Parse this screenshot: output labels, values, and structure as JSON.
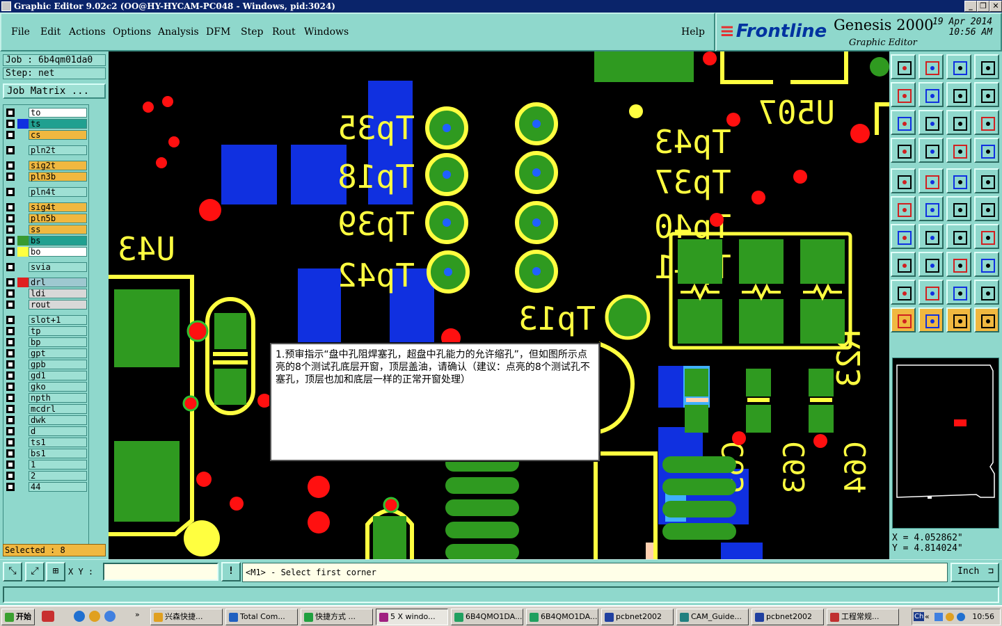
{
  "window": {
    "title": "Graphic Editor 9.02c2  (OO@HY-HYCAM-PC048 - Windows, pid:3024)",
    "minimize": "_",
    "restore": "❐",
    "close": "✕"
  },
  "menu": {
    "items": [
      "File",
      "Edit",
      "Actions",
      "Options",
      "Analysis",
      "DFM",
      "Step",
      "Rout",
      "Windows"
    ],
    "help": "Help"
  },
  "logo": {
    "brand": "Frontline",
    "product": "Genesis 2000",
    "subtitle": "Graphic Editor",
    "date": "19 Apr 2014",
    "time": "10:56 AM"
  },
  "left": {
    "job": "Job : 6b4qm01da0",
    "step": "Step: net",
    "job_matrix": "Job Matrix ...",
    "selected": "Selected : 8",
    "layers": [
      {
        "name": "to",
        "color": "#ffffff",
        "swatch": "#8fd8cc",
        "mark": "⬋"
      },
      {
        "name": "ts",
        "color": "#20a090",
        "swatch": "#1030e0",
        "mark": "⬋"
      },
      {
        "name": "cs",
        "color": "#f0b840",
        "swatch": "#8fd8cc",
        "mark": "⬋"
      },
      {
        "name": "pln2t",
        "color": "#9ee0d4",
        "swatch": "#8fd8cc",
        "mark": ""
      },
      {
        "name": "sig2t",
        "color": "#f0b840",
        "swatch": "#8fd8cc",
        "mark": "⬋"
      },
      {
        "name": "pln3b",
        "color": "#f0b840",
        "swatch": "#8fd8cc",
        "mark": ""
      },
      {
        "name": "pln4t",
        "color": "#9ee0d4",
        "swatch": "#8fd8cc",
        "mark": ""
      },
      {
        "name": "sig4t",
        "color": "#f0b840",
        "swatch": "#8fd8cc",
        "mark": "⬋"
      },
      {
        "name": "pln5b",
        "color": "#f0b840",
        "swatch": "#8fd8cc",
        "mark": ""
      },
      {
        "name": "ss",
        "color": "#f0b840",
        "swatch": "#8fd8cc",
        "mark": "⬋"
      },
      {
        "name": "bs",
        "color": "#20a090",
        "swatch": "#3a9a30",
        "mark": "⬋"
      },
      {
        "name": "bo",
        "color": "#ffffff",
        "swatch": "#ffff40",
        "mark": "⬋"
      },
      {
        "name": "svia",
        "color": "#9ee0d4",
        "swatch": "#8fd8cc",
        "mark": ""
      },
      {
        "name": "drl",
        "color": "#9ec8d0",
        "swatch": "#e02020",
        "mark": "⊞"
      },
      {
        "name": "ldi",
        "color": "#d8d8d8",
        "swatch": "#8fd8cc",
        "mark": ""
      },
      {
        "name": "rout",
        "color": "#d8d8d8",
        "swatch": "#8fd8cc",
        "mark": ""
      },
      {
        "name": "slot+1",
        "color": "#9ee0d4",
        "swatch": "#8fd8cc",
        "mark": ""
      },
      {
        "name": "tp",
        "color": "#9ee0d4",
        "swatch": "#8fd8cc",
        "mark": ""
      },
      {
        "name": "bp",
        "color": "#9ee0d4",
        "swatch": "#8fd8cc",
        "mark": ""
      },
      {
        "name": "gpt",
        "color": "#9ee0d4",
        "swatch": "#8fd8cc",
        "mark": ""
      },
      {
        "name": "gpb",
        "color": "#9ee0d4",
        "swatch": "#8fd8cc",
        "mark": ""
      },
      {
        "name": "gd1",
        "color": "#9ee0d4",
        "swatch": "#8fd8cc",
        "mark": "⬋"
      },
      {
        "name": "gko",
        "color": "#9ee0d4",
        "swatch": "#8fd8cc",
        "mark": "⬋"
      },
      {
        "name": "npth",
        "color": "#9ee0d4",
        "swatch": "#8fd8cc",
        "mark": ""
      },
      {
        "name": "mcdrl",
        "color": "#9ee0d4",
        "swatch": "#8fd8cc",
        "mark": ""
      },
      {
        "name": "dwk",
        "color": "#9ee0d4",
        "swatch": "#8fd8cc",
        "mark": ""
      },
      {
        "name": "d",
        "color": "#9ee0d4",
        "swatch": "#8fd8cc",
        "mark": ""
      },
      {
        "name": "ts1",
        "color": "#9ee0d4",
        "swatch": "#8fd8cc",
        "mark": ""
      },
      {
        "name": "bs1",
        "color": "#9ee0d4",
        "swatch": "#8fd8cc",
        "mark": ""
      },
      {
        "name": "1",
        "color": "#9ee0d4",
        "swatch": "#8fd8cc",
        "mark": ""
      },
      {
        "name": "2",
        "color": "#9ee0d4",
        "swatch": "#8fd8cc",
        "mark": ""
      },
      {
        "name": "44",
        "color": "#9ee0d4",
        "swatch": "#8fd8cc",
        "mark": ""
      }
    ]
  },
  "canvas": {
    "labels": [
      "Tp35",
      "Tp18",
      "Tp39",
      "Tp42",
      "Tp43",
      "Tp37",
      "Tp40",
      "Tp41",
      "Tp13",
      "U507",
      "U43",
      "R23",
      "C63",
      "C64",
      "C65"
    ],
    "colors": {
      "silk": "#ffff40",
      "copper": "#2f9a20",
      "mask": "#1030e0",
      "drill": "#ff1010",
      "lightmask": "#40b0ff"
    }
  },
  "dialog": {
    "message": "1.预审指示“盘中孔阻焊塞孔，超盘中孔能力的允许缩孔”，但如图所示点亮的8个测试孔底层开窗，顶层盖油，请确认（建议：点亮的8个测试孔不塞孔，顶层也加和底层一样的正常开窗处理）"
  },
  "right": {
    "x_label": "X =",
    "x_value": "4.052862\"",
    "y_label": "Y =",
    "y_value": "4.814024\""
  },
  "command": {
    "xy_label": "X Y :",
    "xy_value": "",
    "warn": "!",
    "prompt": "<M1> - Select first corner",
    "units": "Inch"
  },
  "taskbar": {
    "start": "开始",
    "more": "»",
    "tasks": [
      {
        "label": "兴森快捷...",
        "icon": "#e0a020"
      },
      {
        "label": "Total Com...",
        "icon": "#2060c0"
      },
      {
        "label": "快捷方式 ...",
        "icon": "#20a040"
      },
      {
        "label": "5 X windo...",
        "icon": "#a02080",
        "active": true
      },
      {
        "label": "6B4QMO1DA...",
        "icon": "#20a060"
      },
      {
        "label": "6B4QMO1DA...",
        "icon": "#20a060"
      },
      {
        "label": "pcbnet2002",
        "icon": "#2040a0"
      },
      {
        "label": "CAM_Guide...",
        "icon": "#208080"
      },
      {
        "label": "pcbnet2002",
        "icon": "#2040a0"
      },
      {
        "label": "工程常规...",
        "icon": "#c03030"
      }
    ],
    "tray_lang": "Ch",
    "tray_chevron": "«",
    "clock": "10:56"
  }
}
